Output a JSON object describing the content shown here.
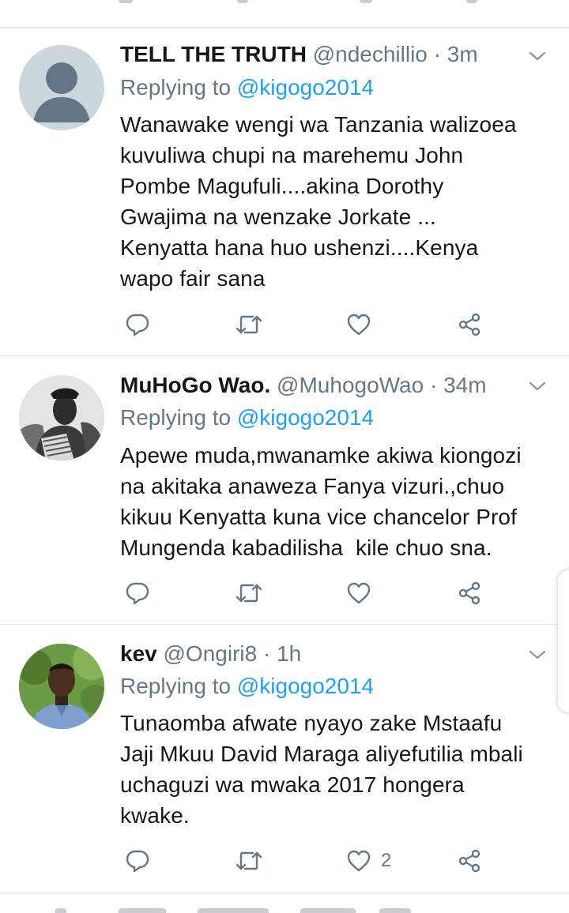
{
  "tweets": [
    {
      "name": "TELL THE TRUTH",
      "handle": "@ndechillio",
      "time": "3m",
      "replying_prefix": "Replying to",
      "replying_to": "@kigogo2014",
      "lines": [
        "Wanawake wengi wa Tanzania walizoea",
        "kuvuliwa chupi na marehemu John",
        "Pombe Magufuli....akina Dorothy",
        "Gwajima na wenzake Jorkate ...",
        "Kenyatta hana huo ushenzi....Kenya",
        "wapo fair sana"
      ],
      "like_count": ""
    },
    {
      "name": "MuHoGo Wao.",
      "handle": "@MuhogoWao",
      "time": "34m",
      "replying_prefix": "Replying to",
      "replying_to": "@kigogo2014",
      "lines": [
        "Apewe muda,mwanamke akiwa kiongozi",
        "na akitaka anaweza Fanya vizuri.,chuo",
        "kikuu Kenyatta kuna vice chancelor Prof",
        "Mungenda kabadilisha  kile chuo sna."
      ],
      "like_count": ""
    },
    {
      "name": "kev",
      "handle": "@Ongiri8",
      "time": "1h",
      "replying_prefix": "Replying to",
      "replying_to": "@kigogo2014",
      "lines": [
        "Tunaomba afwate nyayo zake Mstaafu",
        "Jaji Mkuu David Maraga aliyefutilia mbali",
        "uchaguzi wa mwaka 2017 hongera",
        "kwake."
      ],
      "like_count": "2"
    }
  ],
  "icons": {
    "reply": "reply-icon",
    "retweet": "retweet-icon",
    "like": "heart-icon",
    "share": "share-icon",
    "menu": "chevron-down-icon"
  },
  "colors": {
    "link": "#1da1f2",
    "secondary": "#657786",
    "divider": "#e1e8ed"
  }
}
